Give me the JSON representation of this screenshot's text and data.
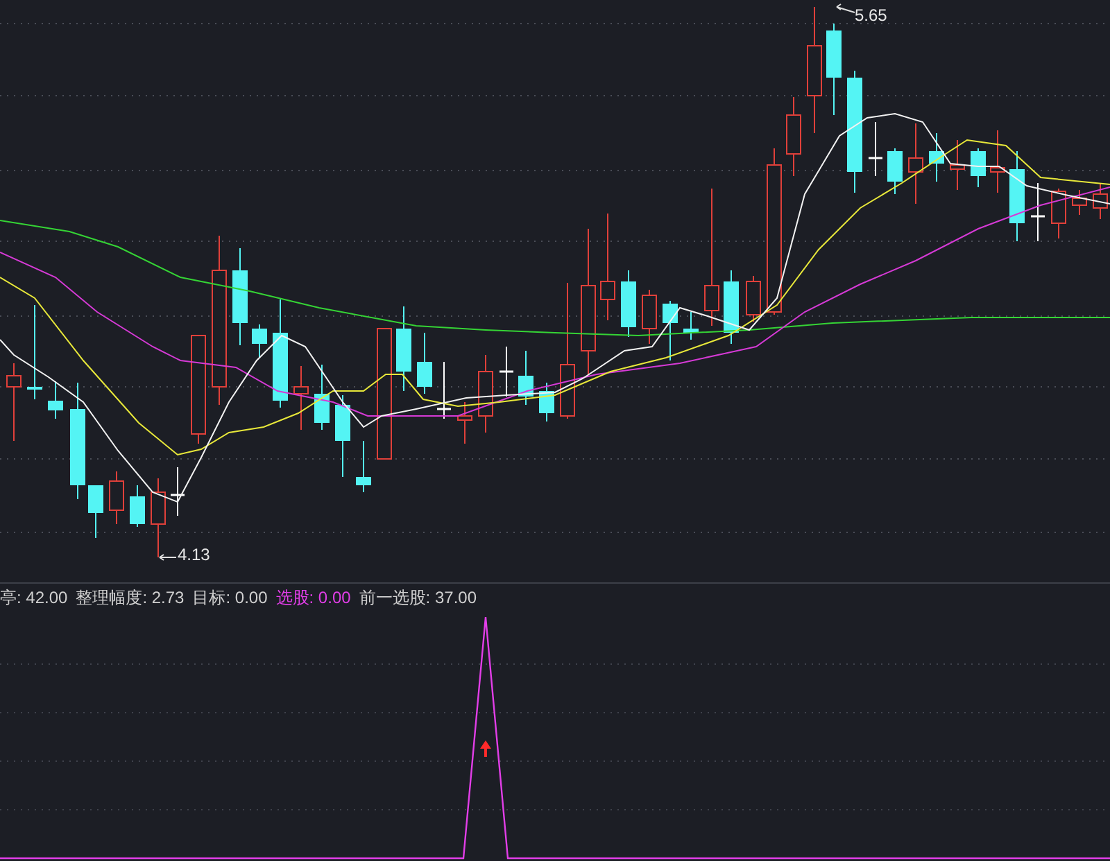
{
  "main_chart": {
    "price_labels": [
      {
        "kind": "high",
        "text": "5.65"
      },
      {
        "kind": "low",
        "text": "4.13"
      }
    ]
  },
  "indicator_panel": {
    "legend": [
      {
        "text": "亭: 42.00",
        "color": "#d0d0d0"
      },
      {
        "text": "整理幅度: 2.73",
        "color": "#d0d0d0"
      },
      {
        "text": "目标: 0.00",
        "color": "#d0d0d0"
      },
      {
        "text": "选股: 0.00",
        "color": "#e23ee8"
      },
      {
        "text": "前一选股: 37.00",
        "color": "#d0d0d0"
      }
    ]
  }
}
